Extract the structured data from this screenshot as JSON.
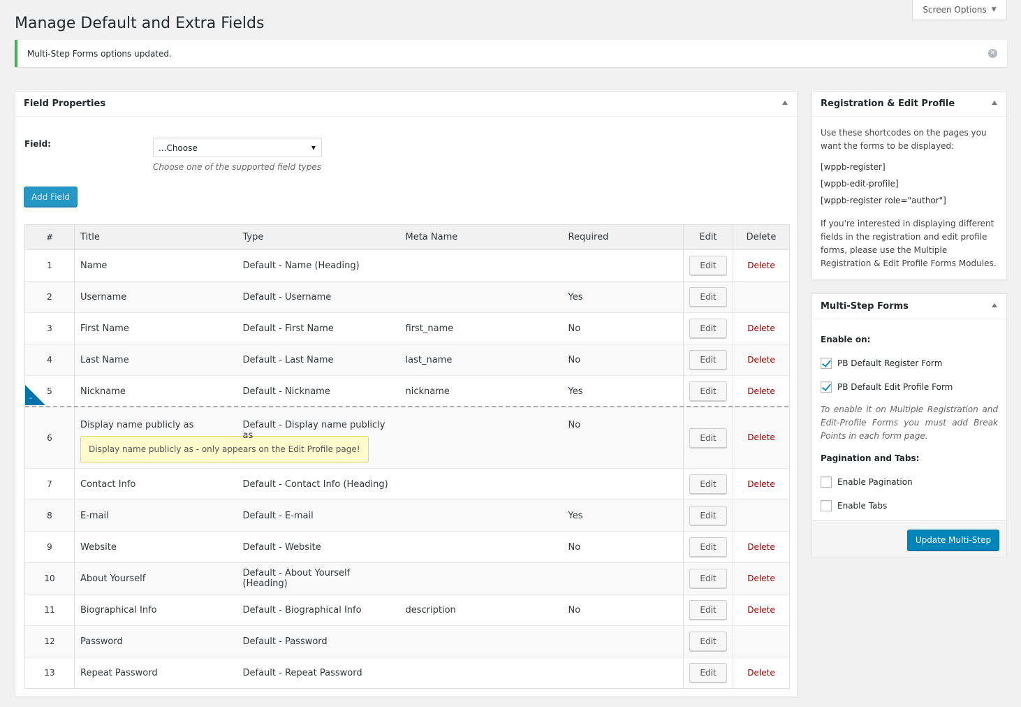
{
  "screen_options": {
    "label": "Screen Options"
  },
  "page": {
    "title": "Manage Default and Extra Fields"
  },
  "notice": {
    "message": "Multi-Step Forms options updated."
  },
  "field_properties": {
    "title": "Field Properties",
    "field_label": "Field:",
    "select_value": "...Choose",
    "select_description": "Choose one of the supported field types",
    "add_button": "Add Field"
  },
  "table": {
    "headers": {
      "num": "#",
      "title": "Title",
      "type": "Type",
      "meta": "Meta Name",
      "required": "Required",
      "edit": "Edit",
      "delete": "Delete"
    },
    "edit_label": "Edit",
    "delete_label": "Delete",
    "rows": [
      {
        "num": "1",
        "title": "Name",
        "type": "Default - Name (Heading)",
        "meta": "",
        "required": "",
        "delete": true
      },
      {
        "num": "2",
        "title": "Username",
        "type": "Default - Username",
        "meta": "",
        "required": "Yes",
        "delete": false
      },
      {
        "num": "3",
        "title": "First Name",
        "type": "Default - First Name",
        "meta": "first_name",
        "required": "No",
        "delete": true
      },
      {
        "num": "4",
        "title": "Last Name",
        "type": "Default - Last Name",
        "meta": "last_name",
        "required": "No",
        "delete": true
      },
      {
        "num": "5",
        "title": "Nickname",
        "type": "Default - Nickname",
        "meta": "nickname",
        "required": "Yes",
        "delete": true
      },
      {
        "num": "6",
        "title": "Display name publicly as",
        "type": "Default - Display name publicly as",
        "meta": "",
        "required": "No",
        "delete": true,
        "tip": "Display name publicly as - only appears on the Edit Profile page!"
      },
      {
        "num": "7",
        "title": "Contact Info",
        "type": "Default - Contact Info (Heading)",
        "meta": "",
        "required": "",
        "delete": true
      },
      {
        "num": "8",
        "title": "E-mail",
        "type": "Default - E-mail",
        "meta": "",
        "required": "Yes",
        "delete": false
      },
      {
        "num": "9",
        "title": "Website",
        "type": "Default - Website",
        "meta": "",
        "required": "No",
        "delete": true
      },
      {
        "num": "10",
        "title": "About Yourself",
        "type": "Default - About Yourself (Heading)",
        "meta": "",
        "required": "",
        "delete": true
      },
      {
        "num": "11",
        "title": "Biographical Info",
        "type": "Default - Biographical Info",
        "meta": "description",
        "required": "No",
        "delete": true
      },
      {
        "num": "12",
        "title": "Password",
        "type": "Default - Password",
        "meta": "",
        "required": "",
        "delete": false
      },
      {
        "num": "13",
        "title": "Repeat Password",
        "type": "Default - Repeat Password",
        "meta": "",
        "required": "",
        "delete": true
      }
    ],
    "breakpoint_label": "-"
  },
  "registration_box": {
    "title": "Registration & Edit Profile",
    "intro": "Use these shortcodes on the pages you want the forms to be displayed:",
    "codes": [
      "[wppb-register]",
      "[wppb-edit-profile]",
      "[wppb-register role=\"author\"]"
    ],
    "outro": "If you're interested in displaying different fields in the registration and edit profile forms, please use the Multiple Registration & Edit Profile Forms Modules."
  },
  "multistep_box": {
    "title": "Multi-Step Forms",
    "enable_on_label": "Enable on:",
    "enable_on": [
      {
        "label": "PB Default Register Form",
        "checked": true
      },
      {
        "label": "PB Default Edit Profile Form",
        "checked": true
      }
    ],
    "note": "To enable it on Multiple Registration and Edit-Profile Forms you must add Break Points in each form page.",
    "pagination_label": "Pagination and Tabs:",
    "pagination_options": [
      {
        "label": "Enable Pagination",
        "checked": false
      },
      {
        "label": "Enable Tabs",
        "checked": false
      }
    ],
    "update_button": "Update Multi-Step"
  },
  "colors": {
    "accent": "#0085ba",
    "notice_success": "#46b450",
    "delete": "#aa0000",
    "breakpoint": "#0073aa"
  }
}
